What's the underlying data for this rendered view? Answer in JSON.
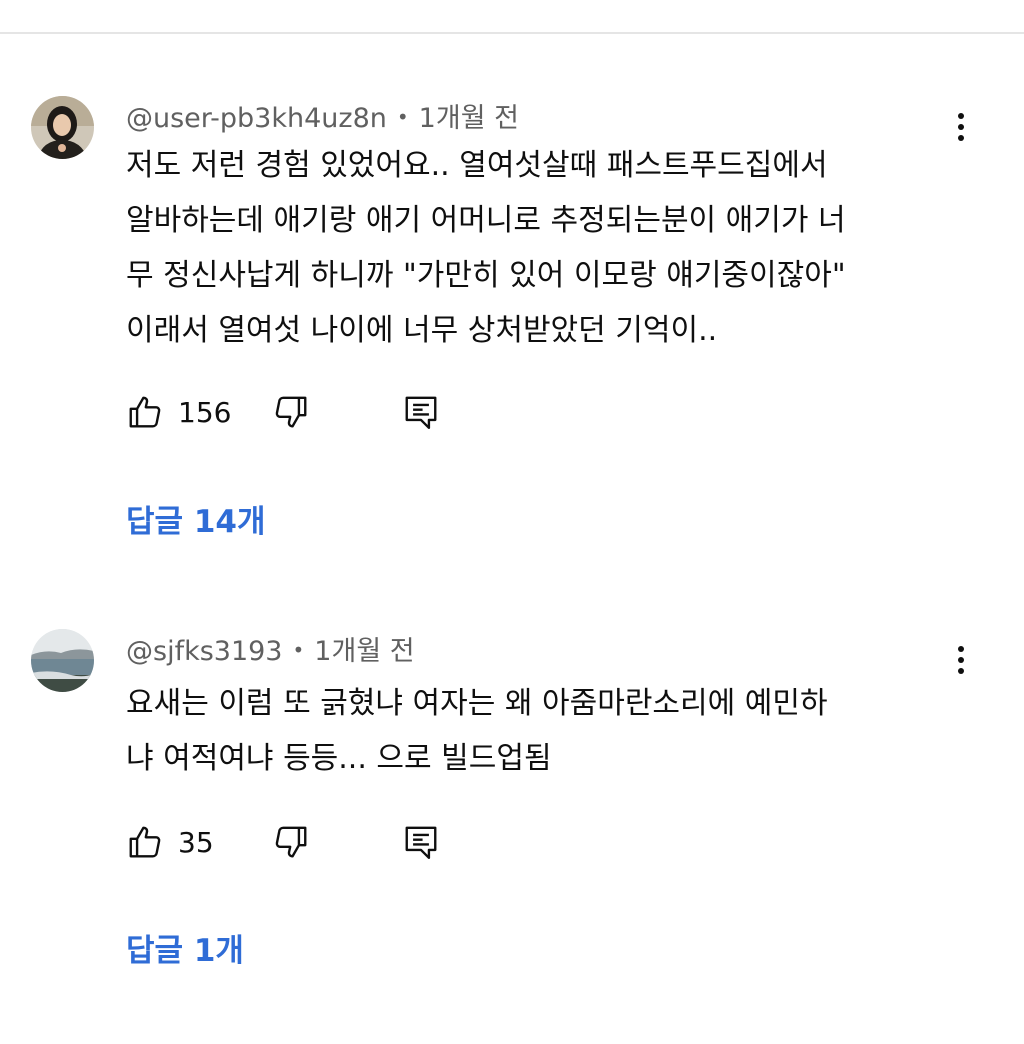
{
  "comments": [
    {
      "username": "@user-pb3kh4uz8n",
      "separator": "•",
      "time": "1개월 전",
      "avatar": "avatar-woman-photo-icon",
      "lines": [
        "저도 저런 경험 있었어요.. 열여섯살때 패스트푸드집에서",
        "알바하는데 애기랑 애기 어머니로 추정되는분이 애기가 너",
        "무 정신사납게 하니까 \"가만히 있어 이모랑 얘기중이잖아\"",
        "이래서 열여섯 나이에 너무 상처받았던 기억이.."
      ],
      "likes": "156",
      "replies_label": "답글 14개"
    },
    {
      "username": "@sjfks3193",
      "separator": "•",
      "time": "1개월 전",
      "avatar": "avatar-seascape-photo-icon",
      "lines": [
        "요새는 이럼 또 긁혔냐 여자는 왜 아줌마란소리에 예민하",
        "냐 여적여냐 등등... 으로 빌드업됨"
      ],
      "likes": "35",
      "replies_label": "답글 1개"
    }
  ],
  "colors": {
    "text": "#0f0f0f",
    "meta": "#606060",
    "replies": "#2f6cd6",
    "divider": "#e5e5e5"
  }
}
